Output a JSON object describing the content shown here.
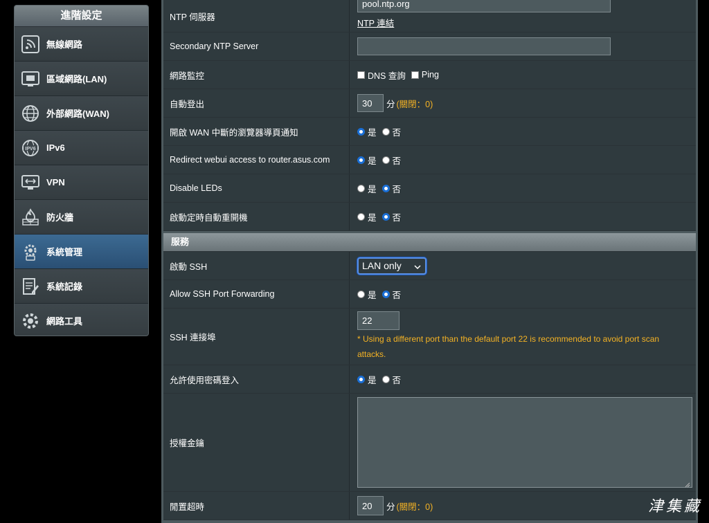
{
  "sidebar": {
    "title": "進階設定",
    "items": [
      {
        "label": "無線網路",
        "icon": "wireless-icon"
      },
      {
        "label": "區域網路(LAN)",
        "icon": "lan-icon"
      },
      {
        "label": "外部網路(WAN)",
        "icon": "globe-icon"
      },
      {
        "label": "IPv6",
        "icon": "ipv6-icon"
      },
      {
        "label": "VPN",
        "icon": "vpn-icon"
      },
      {
        "label": "防火牆",
        "icon": "firewall-icon"
      },
      {
        "label": "系統管理",
        "icon": "gear-icon"
      },
      {
        "label": "系統記錄",
        "icon": "log-icon"
      },
      {
        "label": "網路工具",
        "icon": "tools-icon"
      }
    ],
    "active_index": 6
  },
  "ntp": {
    "label": "NTP 伺服器",
    "value": "pool.ntp.org",
    "link": "NTP 連結"
  },
  "secondary_ntp": {
    "label": "Secondary NTP Server",
    "value": ""
  },
  "net_monitor": {
    "label": "網路監控",
    "opt1": "DNS 查詢",
    "opt2": "Ping"
  },
  "auto_logout": {
    "label": "自動登出",
    "value": "30",
    "unit": "分",
    "hint": "(關閉：0)"
  },
  "wan_notify": {
    "label": "開啟 WAN 中斷的瀏覽器導頁通知",
    "yes": "是",
    "no": "否",
    "selected": "yes"
  },
  "redirect_webui": {
    "label": "Redirect webui access to router.asus.com",
    "yes": "是",
    "no": "否",
    "selected": "yes"
  },
  "disable_leds": {
    "label": "Disable LEDs",
    "yes": "是",
    "no": "否",
    "selected": "no"
  },
  "scheduled_reboot": {
    "label": "啟動定時自動重開機",
    "yes": "是",
    "no": "否",
    "selected": "no"
  },
  "services": {
    "header": "服務",
    "ssh": {
      "label": "啟動 SSH",
      "value": "LAN only"
    },
    "ssh_forwarding": {
      "label": "Allow SSH Port Forwarding",
      "yes": "是",
      "no": "否",
      "selected": "no"
    },
    "ssh_port": {
      "label": "SSH 連接埠",
      "value": "22",
      "warning": "* Using a different port than the default port 22 is recommended to avoid port scan attacks."
    },
    "password_login": {
      "label": "允許使用密碼登入",
      "yes": "是",
      "no": "否",
      "selected": "yes"
    },
    "auth_key": {
      "label": "授權金鑰",
      "value": ""
    },
    "idle_timeout": {
      "label": "閒置超時",
      "value": "20",
      "unit": "分",
      "hint": "(關閉：0)"
    }
  },
  "watermark": "津集藏",
  "colors": {
    "accent": "#1a6fd6",
    "hint": "#f5b324",
    "active_nav": "#2a4f74"
  }
}
